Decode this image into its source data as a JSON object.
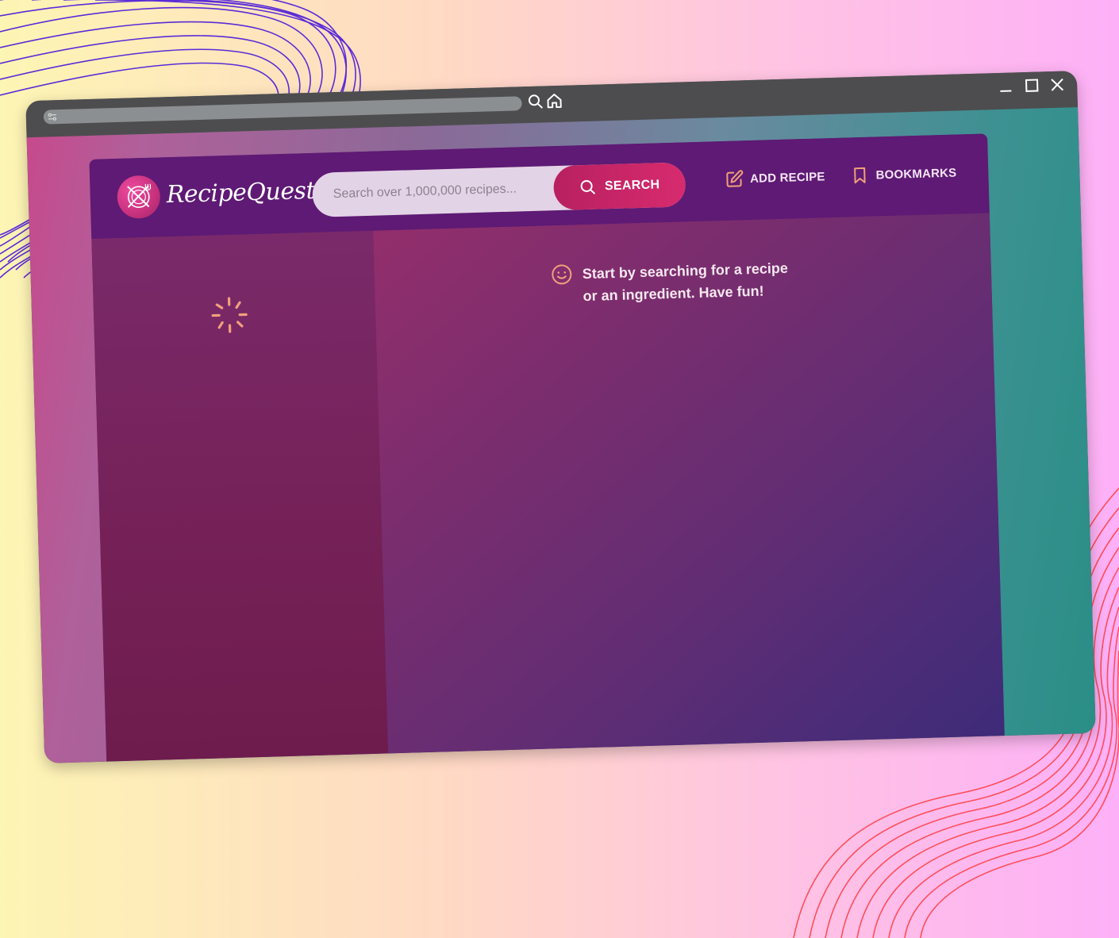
{
  "browser": {
    "icons": [
      "tune-icon",
      "search-icon",
      "home-icon",
      "minimize-icon",
      "maximize-icon",
      "close-icon"
    ]
  },
  "app": {
    "brand": "RecipeQuest",
    "search": {
      "placeholder": "Search over 1,000,000 recipes...",
      "button_label": "SEARCH"
    },
    "nav": {
      "add_recipe": "ADD RECIPE",
      "bookmarks": "BOOKMARKS"
    },
    "results": {
      "state": "loading"
    },
    "message": "Start by searching for a recipe or an ingredient. Have fun!"
  },
  "colors": {
    "header": "#5e1a74",
    "accent": "#d72b6f",
    "icon_accent": "#f1a07b",
    "search_bg": "#e3d3e6"
  }
}
